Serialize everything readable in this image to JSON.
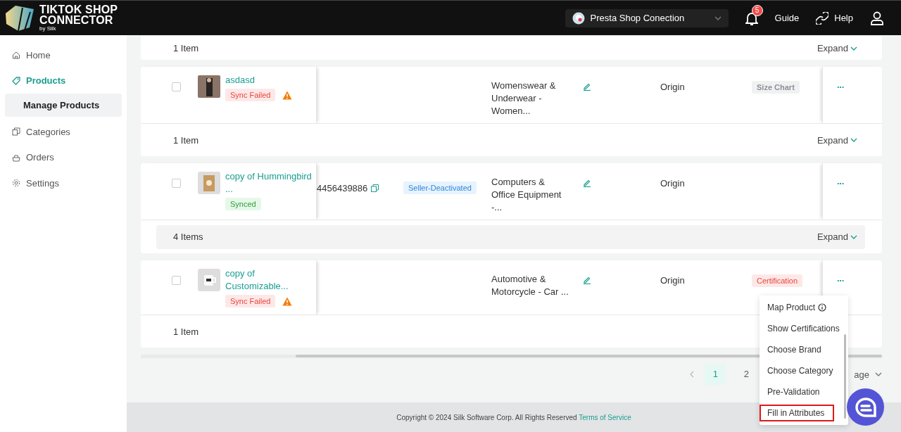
{
  "header": {
    "logo": {
      "line_1": "TIKTOK SHOP",
      "line_2": "CONNECTOR",
      "byline": "by Silk"
    },
    "store_select": {
      "value": "Presta Shop Conection"
    },
    "notifications": {
      "count": "5"
    },
    "links": [
      {
        "label": "Guide",
        "kind": "plain"
      },
      {
        "label": "Help",
        "kind": "link"
      }
    ]
  },
  "sidebar": {
    "items": [
      {
        "label": "Home",
        "selected": false
      },
      {
        "label": "Products",
        "selected": true,
        "children": [
          {
            "label": "Manage Products",
            "selected": true
          }
        ]
      },
      {
        "label": "Categories",
        "selected": false
      },
      {
        "label": "Orders",
        "selected": false
      },
      {
        "label": "Settings",
        "selected": false
      }
    ]
  },
  "table": {
    "rows": [
      {
        "kind": "summary",
        "count": "1 Item",
        "expand": "Expand",
        "highlighted": false
      },
      {
        "kind": "product",
        "checked": false,
        "name": "asdasd",
        "status": {
          "label": "Sync Failed",
          "kind": "failed"
        },
        "warning": true,
        "category": "Womenswear & Underwear - Women...",
        "origin": "Origin",
        "tag": {
          "label": "Size Chart",
          "kind": "neutral"
        },
        "more": "···"
      },
      {
        "kind": "summary",
        "count": "1 Item",
        "expand": "Expand",
        "highlighted": false
      },
      {
        "kind": "product",
        "checked": false,
        "name": "copy of Hummingbird ...",
        "status": {
          "label": "Synced",
          "kind": "synced"
        },
        "warning": false,
        "product_id": "4456439886",
        "state": "Seller-Deactivated",
        "category": "Computers & Office Equipment -...",
        "origin": "Origin",
        "more": "···"
      },
      {
        "kind": "summary",
        "count": "4 Items",
        "expand": "Expand",
        "highlighted": true
      },
      {
        "kind": "product",
        "checked": false,
        "name": "copy of Customizable...",
        "status": {
          "label": "Sync Failed",
          "kind": "failed"
        },
        "warning": true,
        "category": "Automotive & Motorcycle - Car ...",
        "origin": "Origin",
        "tag": {
          "label": "Certification",
          "kind": "alert"
        },
        "more": "···"
      },
      {
        "kind": "summary",
        "count": "1 Item",
        "expand": "",
        "highlighted": false
      }
    ]
  },
  "pagination": {
    "pages": [
      {
        "label": "1",
        "selected": true
      },
      {
        "label": "2",
        "selected": false
      }
    ],
    "page_size": "age"
  },
  "action_menu": {
    "items": [
      {
        "label": "Map Product",
        "info": true,
        "highlighted": false
      },
      {
        "label": "Show Certifications",
        "info": false,
        "highlighted": false
      },
      {
        "label": "Choose Brand",
        "info": false,
        "highlighted": false
      },
      {
        "label": "Choose Category",
        "info": false,
        "highlighted": false
      },
      {
        "label": "Pre-Validation",
        "info": false,
        "highlighted": false
      },
      {
        "label": "Fill in Attributes",
        "info": false,
        "highlighted": true
      }
    ]
  },
  "footer": {
    "text": "Copyright © 2024 Silk Software Corp. All Rights Reserved",
    "link": "Terms of Service"
  }
}
